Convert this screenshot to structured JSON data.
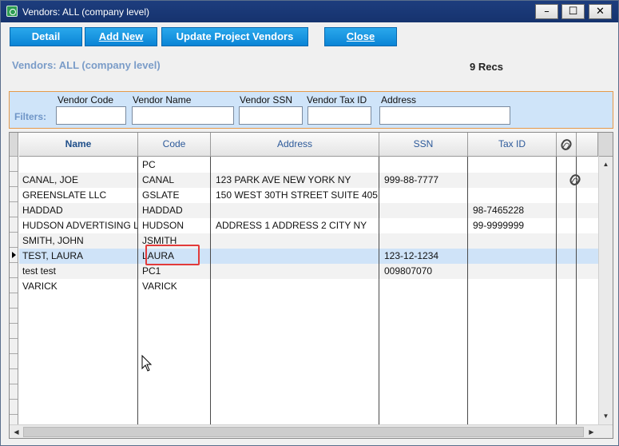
{
  "window": {
    "title": "Vendors: ALL (company level)",
    "min_glyph": "–",
    "max_glyph": "☐",
    "close_glyph": "✕"
  },
  "toolbar": {
    "detail": "Detail",
    "add_new": "Add New",
    "update_project_vendors": "Update Project Vendors",
    "close": "Close"
  },
  "header": {
    "subtitle": "Vendors: ALL (company level)",
    "record_count": "9 Recs"
  },
  "filters": {
    "label": "Filters:",
    "vendor_code_label": "Vendor Code",
    "vendor_code_value": "",
    "vendor_name_label": "Vendor Name",
    "vendor_name_value": "",
    "vendor_ssn_label": "Vendor SSN",
    "vendor_ssn_value": "",
    "vendor_tax_id_label": "Vendor Tax ID",
    "vendor_tax_id_value": "",
    "address_label": "Address",
    "address_value": ""
  },
  "grid": {
    "columns": {
      "name": "Name",
      "code": "Code",
      "address": "Address",
      "ssn": "SSN",
      "tax_id": "Tax ID"
    },
    "rows": [
      {
        "name": "",
        "code": "PC",
        "address": "",
        "ssn": "",
        "tax_id": ""
      },
      {
        "name": "CANAL, JOE",
        "code": "CANAL",
        "address": "123 PARK AVE   NEW YORK NY",
        "ssn": "999-88-7777",
        "tax_id": ""
      },
      {
        "name": "GREENSLATE LLC",
        "code": "GSLATE",
        "address": "150 WEST 30TH STREET SUITE 405",
        "ssn": "",
        "tax_id": ""
      },
      {
        "name": "HADDAD",
        "code": "HADDAD",
        "address": "",
        "ssn": "",
        "tax_id": "98-7465228"
      },
      {
        "name": "HUDSON ADVERTISING L",
        "code": "HUDSON",
        "address": "ADDRESS 1 ADDRESS 2  CITY NY",
        "ssn": "",
        "tax_id": "99-9999999"
      },
      {
        "name": "SMITH, JOHN",
        "code": "JSMITH",
        "address": "",
        "ssn": "",
        "tax_id": ""
      },
      {
        "name": "TEST, LAURA",
        "code": "LAURA",
        "address": "",
        "ssn": "123-12-1234",
        "tax_id": ""
      },
      {
        "name": "test test",
        "code": "PC1",
        "address": "",
        "ssn": "009807070",
        "tax_id": ""
      },
      {
        "name": "VARICK",
        "code": "VARICK",
        "address": "",
        "ssn": "",
        "tax_id": ""
      }
    ],
    "selected_row_index": 6,
    "attachment_row_index": 1
  },
  "colors": {
    "titlebar": "#1d3d7e",
    "button": "#1496e0",
    "filter_bg": "#cfe4f9",
    "selected_row": "#cfe3f8",
    "highlight": "#e23a3a"
  }
}
